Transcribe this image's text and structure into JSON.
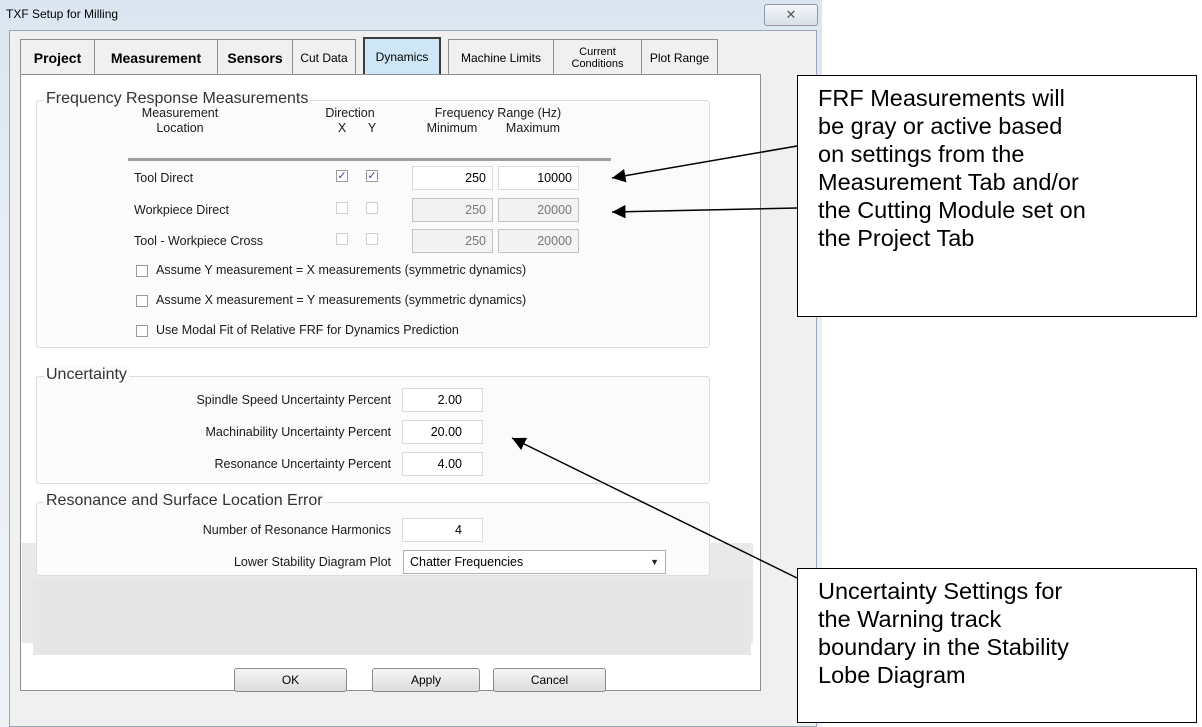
{
  "window": {
    "title": "TXF Setup for Milling",
    "close_glyph": "✕"
  },
  "tabs": [
    {
      "label": "Project"
    },
    {
      "label": "Measurement"
    },
    {
      "label": "Sensors"
    },
    {
      "label": "Cut Data"
    },
    {
      "label": "Dynamics"
    },
    {
      "label": "Machine Limits"
    },
    {
      "label": "Current Conditions"
    },
    {
      "label": "Plot Range"
    }
  ],
  "frf": {
    "title": "Frequency Response Measurements",
    "headers": {
      "location": "Measurement\nLocation",
      "direction": "Direction",
      "x": "X",
      "y": "Y",
      "freq": "Frequency Range (Hz)",
      "min": "Minimum",
      "max": "Maximum"
    },
    "rows": [
      {
        "label": "Tool Direct",
        "x": true,
        "y": true,
        "min": "250",
        "max": "10000"
      },
      {
        "label": "Workpiece Direct",
        "x": false,
        "y": false,
        "min": "250",
        "max": "20000"
      },
      {
        "label": "Tool - Workpiece Cross",
        "x": false,
        "y": false,
        "min": "250",
        "max": "20000"
      }
    ],
    "options": [
      "Assume Y measurement = X measurements (symmetric dynamics)",
      "Assume X measurement = Y measurements (symmetric dynamics)",
      "Use Modal Fit of Relative FRF for Dynamics Prediction"
    ]
  },
  "uncertainty": {
    "title": "Uncertainty",
    "rows": [
      {
        "label": "Spindle Speed Uncertainty Percent",
        "value": "2.00"
      },
      {
        "label": "Machinability Uncertainty Percent",
        "value": "20.00"
      },
      {
        "label": "Resonance Uncertainty Percent",
        "value": "4.00"
      }
    ]
  },
  "resonance": {
    "title": "Resonance and Surface Location Error",
    "harmonics_label": "Number of Resonance Harmonics",
    "harmonics_value": "4",
    "plot_label": "Lower Stability Diagram Plot",
    "plot_value": "Chatter Frequencies"
  },
  "buttons": {
    "ok": "OK",
    "apply": "Apply",
    "cancel": "Cancel"
  },
  "annotations": {
    "frf_note": [
      "FRF Measurements will",
      "be gray or active based",
      "on settings from the",
      "Measurement Tab and/or",
      "the Cutting Module set on",
      "the Project Tab"
    ],
    "uncertainty_note": [
      "Uncertainty Settings for",
      "the Warning track",
      "boundary in the Stability",
      "Lobe Diagram"
    ]
  }
}
